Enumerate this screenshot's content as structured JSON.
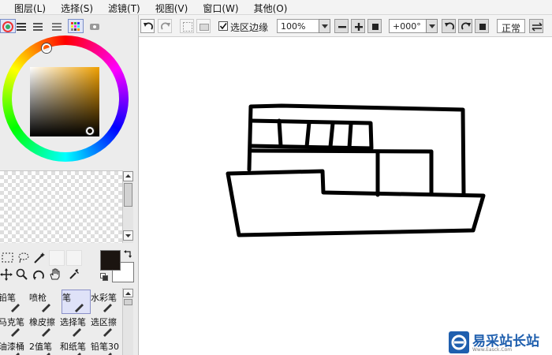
{
  "menu": {
    "items": [
      "图层(L)",
      "选择(S)",
      "滤镜(T)",
      "视图(V)",
      "窗口(W)",
      "其他(O)"
    ]
  },
  "toolbar": {
    "selection_edge_label": "选区边缘",
    "selection_edge_checked": true,
    "zoom_value": "100%",
    "rotation_value": "+000°",
    "blend_mode": "正常"
  },
  "brushes": [
    {
      "label": "铅笔",
      "icon": "pencil-icon"
    },
    {
      "label": "喷枪",
      "icon": "airbrush-icon"
    },
    {
      "label": "笔",
      "icon": "pen-icon",
      "active": true
    },
    {
      "label": "水彩笔",
      "icon": "watercolor-icon"
    },
    {
      "label": "马克笔",
      "icon": "marker-icon"
    },
    {
      "label": "橡皮擦",
      "icon": "eraser-icon"
    },
    {
      "label": "选择笔",
      "icon": "select-pen-icon"
    },
    {
      "label": "选区擦",
      "icon": "select-eraser-icon"
    },
    {
      "label": "油漆桶",
      "icon": "bucket-icon"
    },
    {
      "label": "2值笔",
      "icon": "binary-pen-icon"
    },
    {
      "label": "和纸笔",
      "icon": "washi-pen-icon"
    },
    {
      "label": "铅笔30",
      "icon": "pencil30-icon"
    }
  ],
  "colors": {
    "foreground": "#1b1410",
    "background": "#ffffff",
    "accent": "#7a8ec9"
  },
  "watermark": {
    "text": "易采站长站",
    "sub": "Www.Easck.Com"
  }
}
